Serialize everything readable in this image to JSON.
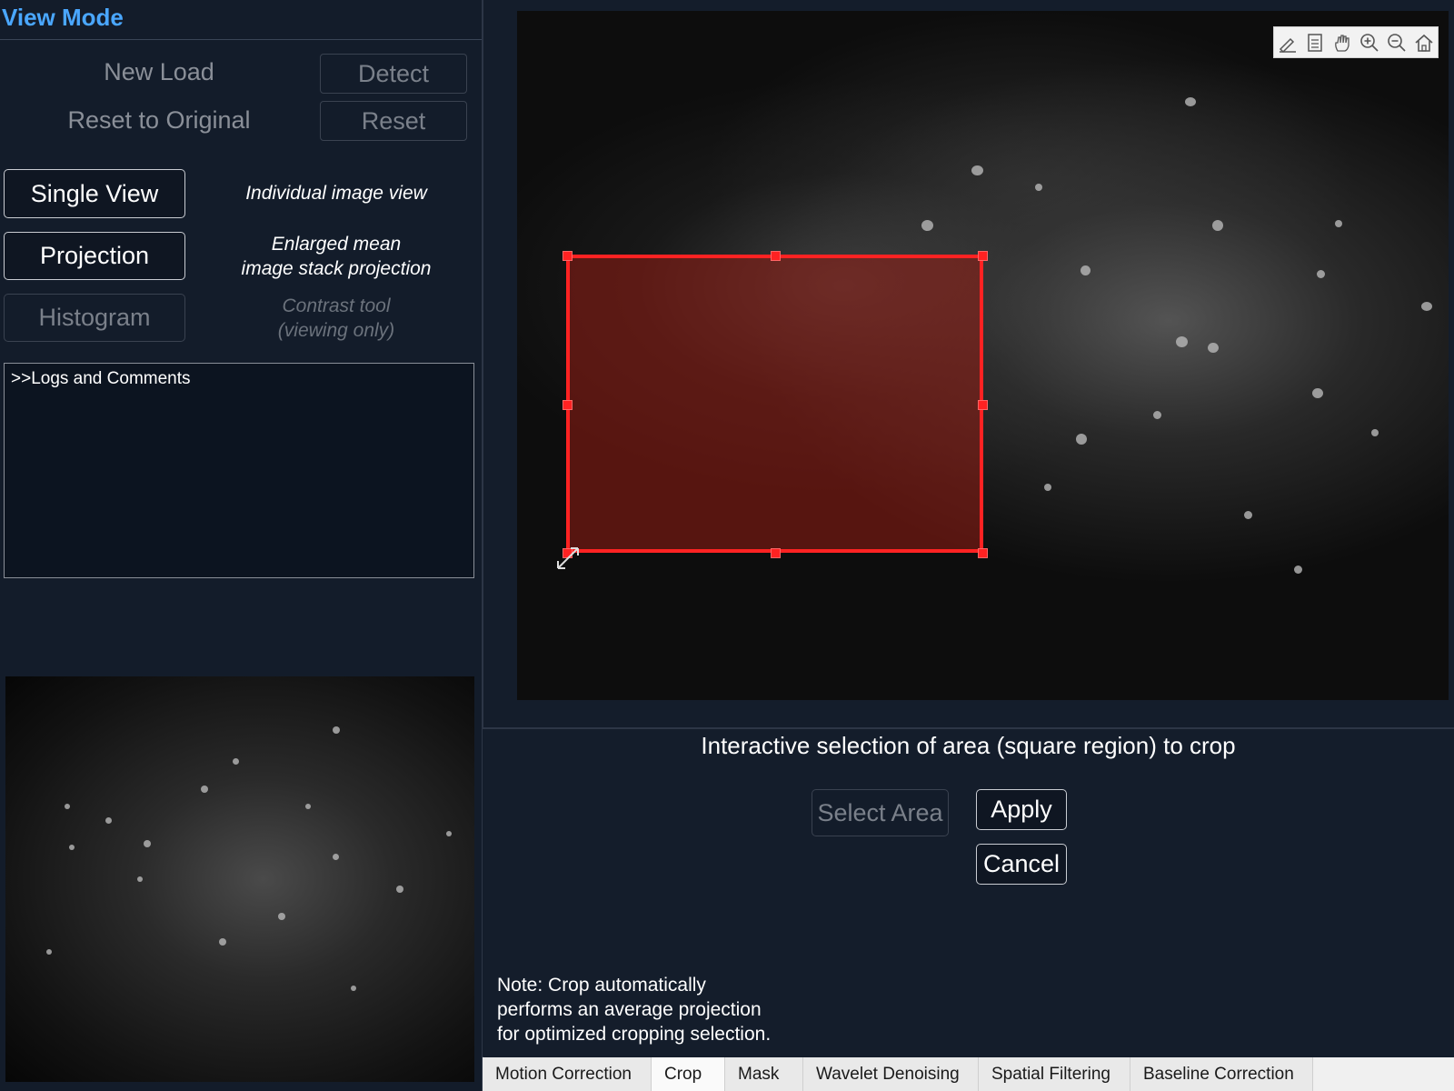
{
  "left_panel": {
    "title": "View Mode",
    "new_load": "New Load",
    "detect": "Detect",
    "reset_to_original": "Reset to Original",
    "reset": "Reset",
    "single_view": "Single View",
    "single_view_desc": "Individual image view",
    "projection": "Projection",
    "projection_desc_line1": "Enlarged mean",
    "projection_desc_line2": "image stack projection",
    "histogram": "Histogram",
    "histogram_desc_line1": "Contrast tool",
    "histogram_desc_line2": "(viewing only)",
    "logs": ">>Logs and Comments"
  },
  "image_toolbar": {
    "icons": [
      "brush-icon",
      "legend-icon",
      "pan-hand-icon",
      "zoom-in-icon",
      "zoom-out-icon",
      "home-icon"
    ]
  },
  "crop_panel": {
    "heading": "Interactive selection of area (square region) to crop",
    "select_area": "Select Area",
    "apply": "Apply",
    "cancel": "Cancel",
    "note_line1": "Note: Crop automatically",
    "note_line2": "performs an average projection",
    "note_line3": "for optimized cropping selection."
  },
  "tabs": [
    {
      "label": "Motion Correction",
      "active": false
    },
    {
      "label": "Crop",
      "active": true
    },
    {
      "label": "Mask",
      "active": false
    },
    {
      "label": "Wavelet Denoising",
      "active": false
    },
    {
      "label": "Spatial Filtering",
      "active": false
    },
    {
      "label": "Baseline Correction",
      "active": false
    }
  ],
  "colors": {
    "title_accent": "#4aa7ff",
    "selection_border": "#ff2222",
    "background": "#141d2b"
  }
}
